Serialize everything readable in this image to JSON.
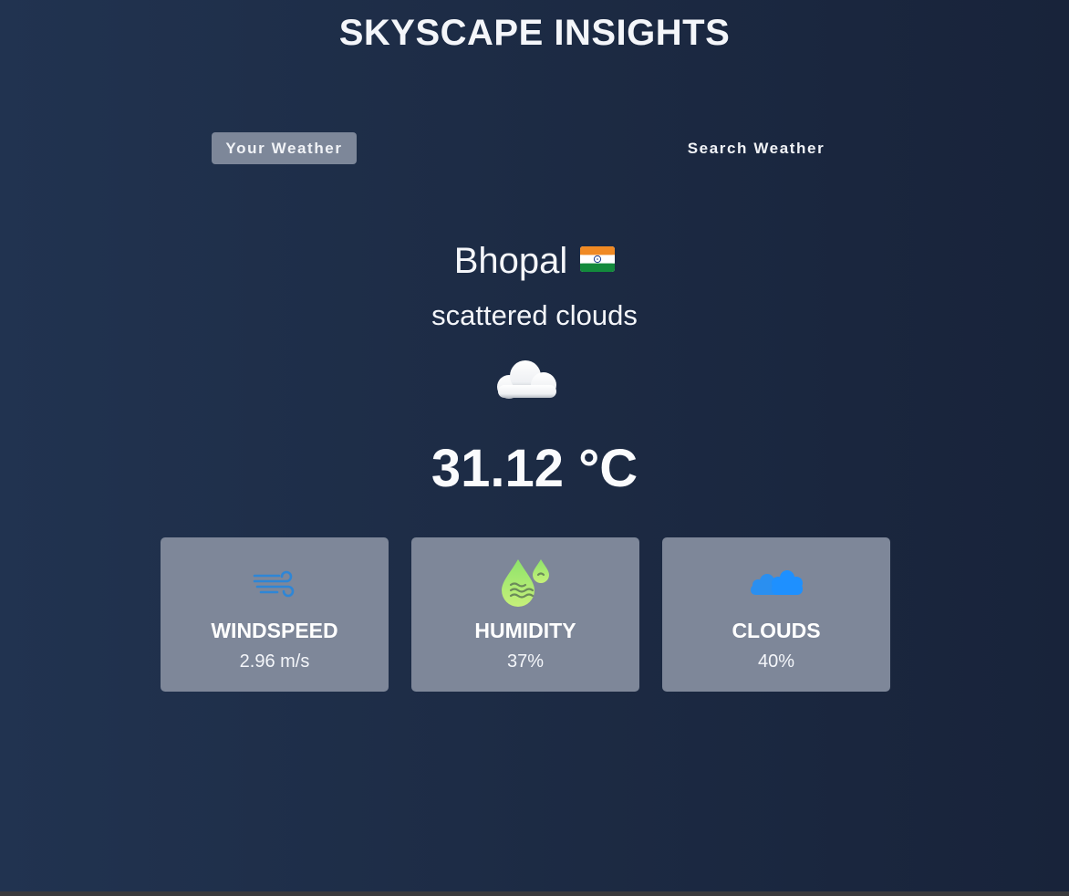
{
  "app": {
    "title": "SKYSCAPE INSIGHTS"
  },
  "tabs": [
    {
      "label": "Your Weather",
      "active": true
    },
    {
      "label": "Search Weather",
      "active": false
    }
  ],
  "weather": {
    "city": "Bhopal",
    "country_flag": "india-flag-icon",
    "description": "scattered clouds",
    "condition_icon": "cloud-icon",
    "temperature": "31.12 °C"
  },
  "stats": [
    {
      "title": "WINDSPEED",
      "value": "2.96 m/s",
      "icon": "wind-icon"
    },
    {
      "title": "HUMIDITY",
      "value": "37%",
      "icon": "humidity-icon"
    },
    {
      "title": "CLOUDS",
      "value": "40%",
      "icon": "clouds-icon"
    }
  ],
  "colors": {
    "background": "#1e2e48",
    "active_tab": "#7d8799",
    "card": "#7e8799",
    "wind_icon": "#2e86d6",
    "humidity_icon": "#a3e66f",
    "clouds_icon": "#1e90ff"
  }
}
